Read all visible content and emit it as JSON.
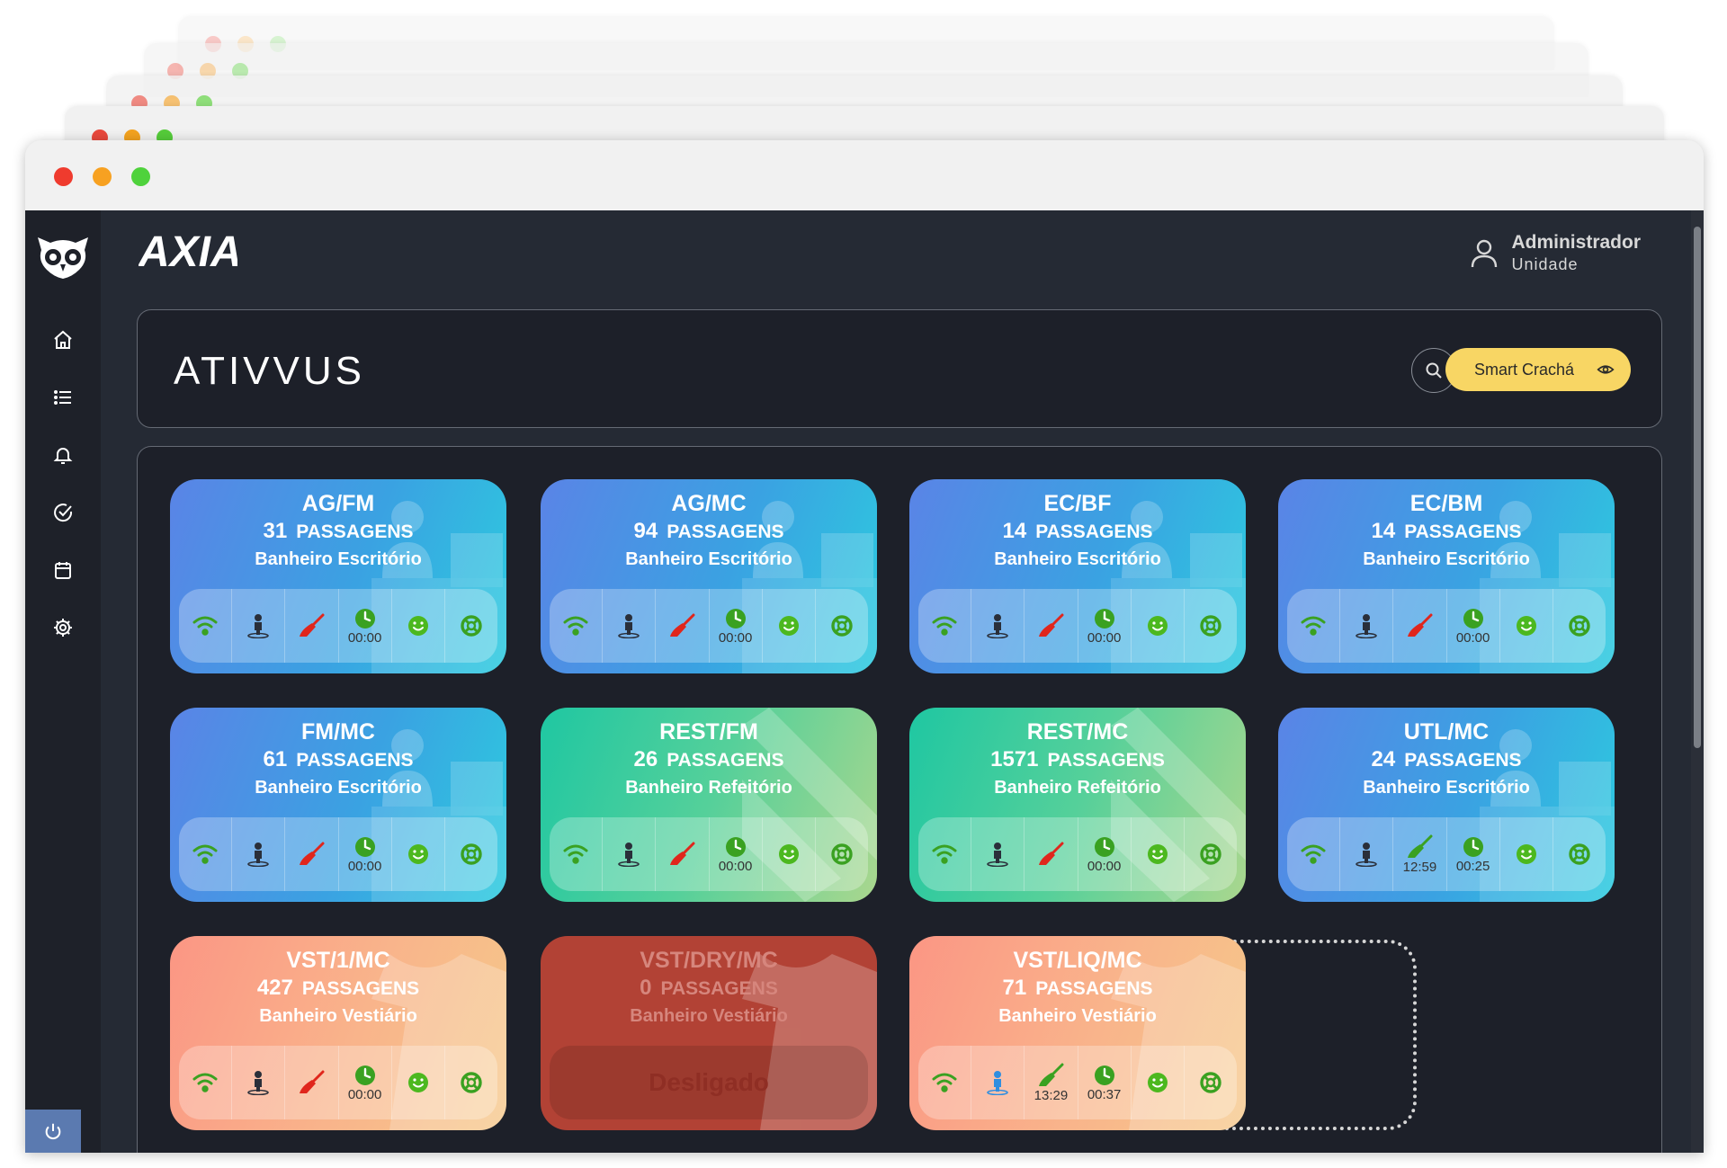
{
  "app": {
    "brand": "AXIA",
    "header_title": "ATIVVUS",
    "user": {
      "name": "Administrador",
      "role": "Unidade"
    },
    "smart_button": "Smart Crachá",
    "sidebar": [
      {
        "icon": "home-icon"
      },
      {
        "icon": "list-icon"
      },
      {
        "icon": "bell-icon"
      },
      {
        "icon": "check-circle-icon"
      },
      {
        "icon": "calendar-icon"
      },
      {
        "icon": "gear-icon"
      }
    ],
    "colors": {
      "accent_yellow": "#f8d664",
      "bg_dark": "#1d2029",
      "sidebar": "#1e2129"
    }
  },
  "cards": [
    {
      "name": "AG/FM",
      "count": "31",
      "count_label": "PASSAGENS",
      "location": "Banheiro Escritório",
      "theme": "blue",
      "clean_time": "",
      "timer": "00:00",
      "clean_state": "red",
      "person_state": "dark"
    },
    {
      "name": "AG/MC",
      "count": "94",
      "count_label": "PASSAGENS",
      "location": "Banheiro Escritório",
      "theme": "blue",
      "clean_time": "",
      "timer": "00:00",
      "clean_state": "red",
      "person_state": "dark"
    },
    {
      "name": "EC/BF",
      "count": "14",
      "count_label": "PASSAGENS",
      "location": "Banheiro Escritório",
      "theme": "blue",
      "clean_time": "",
      "timer": "00:00",
      "clean_state": "red",
      "person_state": "dark"
    },
    {
      "name": "EC/BM",
      "count": "14",
      "count_label": "PASSAGENS",
      "location": "Banheiro Escritório",
      "theme": "blue",
      "clean_time": "",
      "timer": "00:00",
      "clean_state": "red",
      "person_state": "dark"
    },
    {
      "name": "FM/MC",
      "count": "61",
      "count_label": "PASSAGENS",
      "location": "Banheiro Escritório",
      "theme": "blue",
      "clean_time": "",
      "timer": "00:00",
      "clean_state": "red",
      "person_state": "dark"
    },
    {
      "name": "REST/FM",
      "count": "26",
      "count_label": "PASSAGENS",
      "location": "Banheiro Refeitório",
      "theme": "green",
      "clean_time": "",
      "timer": "00:00",
      "clean_state": "red",
      "person_state": "dark"
    },
    {
      "name": "REST/MC",
      "count": "1571",
      "count_label": "PASSAGENS",
      "location": "Banheiro Refeitório",
      "theme": "green",
      "clean_time": "",
      "timer": "00:00",
      "clean_state": "red",
      "person_state": "dark"
    },
    {
      "name": "UTL/MC",
      "count": "24",
      "count_label": "PASSAGENS",
      "location": "Banheiro Escritório",
      "theme": "blue",
      "clean_time": "12:59",
      "timer": "00:25",
      "clean_state": "green",
      "person_state": "dark"
    },
    {
      "name": "VST/1/MC",
      "count": "427",
      "count_label": "PASSAGENS",
      "location": "Banheiro Vestiário",
      "theme": "orange",
      "clean_time": "",
      "timer": "00:00",
      "clean_state": "red",
      "person_state": "dark"
    },
    {
      "name": "VST/DRY/MC",
      "count": "0",
      "count_label": "PASSAGENS",
      "location": "Banheiro Vestiário",
      "theme": "red",
      "off": "Desligado"
    },
    {
      "name": "VST/LIQ/MC",
      "count": "71",
      "count_label": "PASSAGENS",
      "location": "Banheiro Vestiário",
      "theme": "orange",
      "clean_time": "13:29",
      "timer": "00:37",
      "clean_state": "green",
      "person_state": "blue"
    }
  ]
}
